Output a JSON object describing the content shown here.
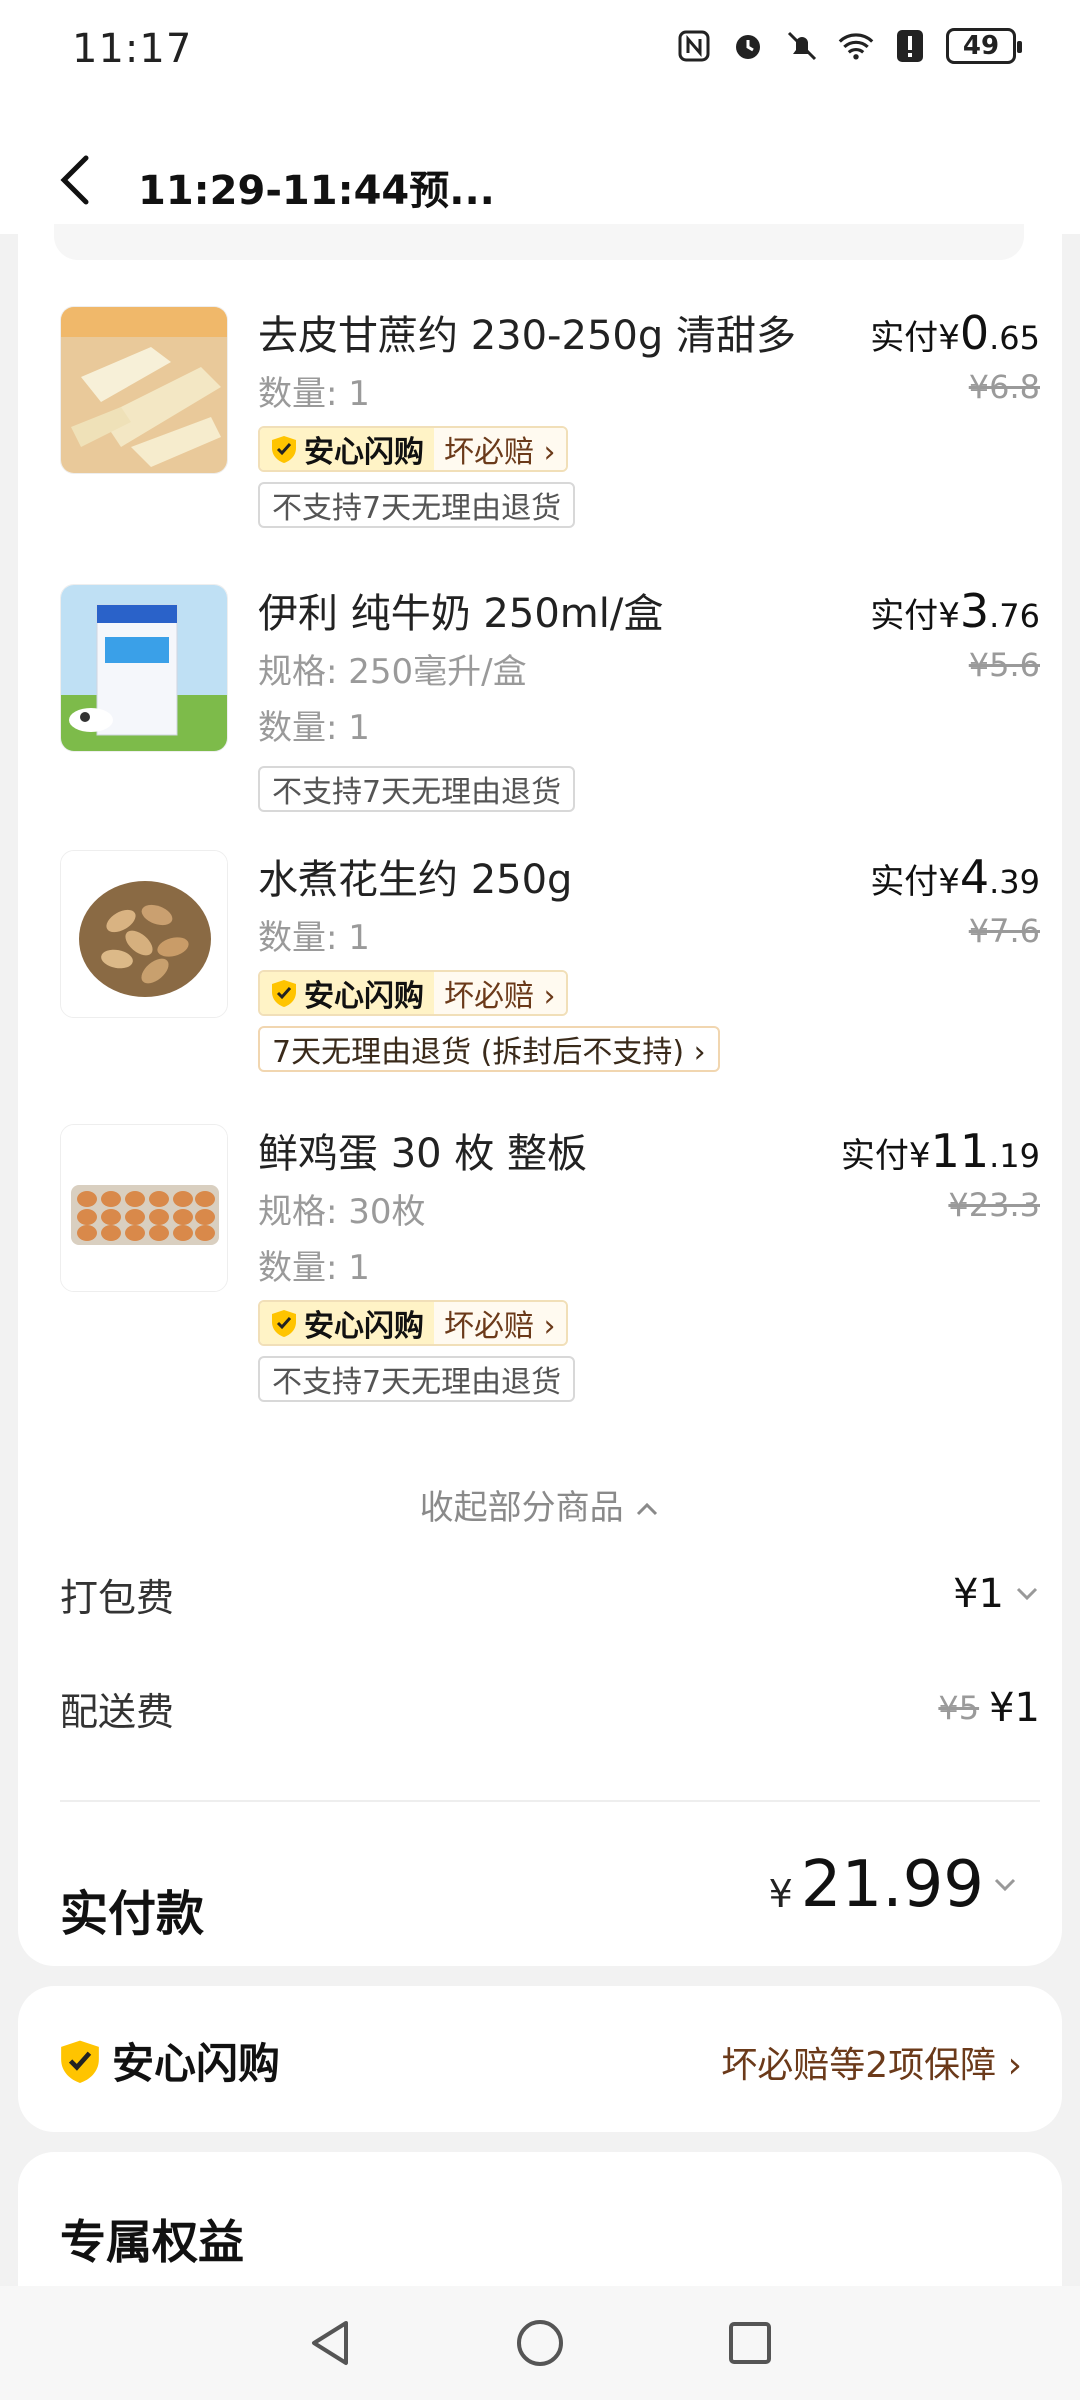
{
  "status_bar": {
    "time": "11:17",
    "battery": "49"
  },
  "header": {
    "title": "11:29-11:44预..."
  },
  "items": [
    {
      "name": "去皮甘蔗约 230-250g 清甜多",
      "details": [
        "数量: 1"
      ],
      "paid_prefix": "实付",
      "yen": "¥",
      "price_int": "0",
      "price_dec": ".65",
      "original": "¥6.8",
      "badge": {
        "left": "安心闪购",
        "right": "坏必赔 ›"
      },
      "tag": "不支持7天无理由退货",
      "tag_style": "grey"
    },
    {
      "name": "伊利 纯牛奶 250ml/盒",
      "details": [
        "规格: 250毫升/盒",
        "数量: 1"
      ],
      "paid_prefix": "实付",
      "yen": "¥",
      "price_int": "3",
      "price_dec": ".76",
      "original": "¥5.6",
      "badge": null,
      "tag": "不支持7天无理由退货",
      "tag_style": "grey"
    },
    {
      "name": "水煮花生约 250g",
      "details": [
        "数量: 1"
      ],
      "paid_prefix": "实付",
      "yen": "¥",
      "price_int": "4",
      "price_dec": ".39",
      "original": "¥7.6",
      "badge": {
        "left": "安心闪购",
        "right": "坏必赔 ›"
      },
      "tag": "7天无理由退货 (拆封后不支持) ›",
      "tag_style": "orange"
    },
    {
      "name": "鲜鸡蛋 30 枚 整板",
      "details": [
        "规格: 30枚",
        "数量: 1"
      ],
      "paid_prefix": "实付",
      "yen": "¥",
      "price_int": "11",
      "price_dec": ".19",
      "original": "¥23.3",
      "badge": {
        "left": "安心闪购",
        "right": "坏必赔 ›"
      },
      "tag": "不支持7天无理由退货",
      "tag_style": "grey"
    }
  ],
  "collapse_label": "收起部分商品",
  "fees": {
    "packing_label": "打包费",
    "packing_value": "¥1",
    "delivery_label": "配送费",
    "delivery_original": "¥5",
    "delivery_value": "¥1"
  },
  "total": {
    "label": "实付款",
    "yen": "¥",
    "value": "21.99"
  },
  "assurance": {
    "title": "安心闪购",
    "link": "坏必赔等2项保障 ›"
  },
  "benefits": {
    "title": "专属权益"
  },
  "colors": {
    "accent": "#ff7a00",
    "badge_bg": "#fff3c6",
    "brown_text": "#6b3a1a"
  }
}
